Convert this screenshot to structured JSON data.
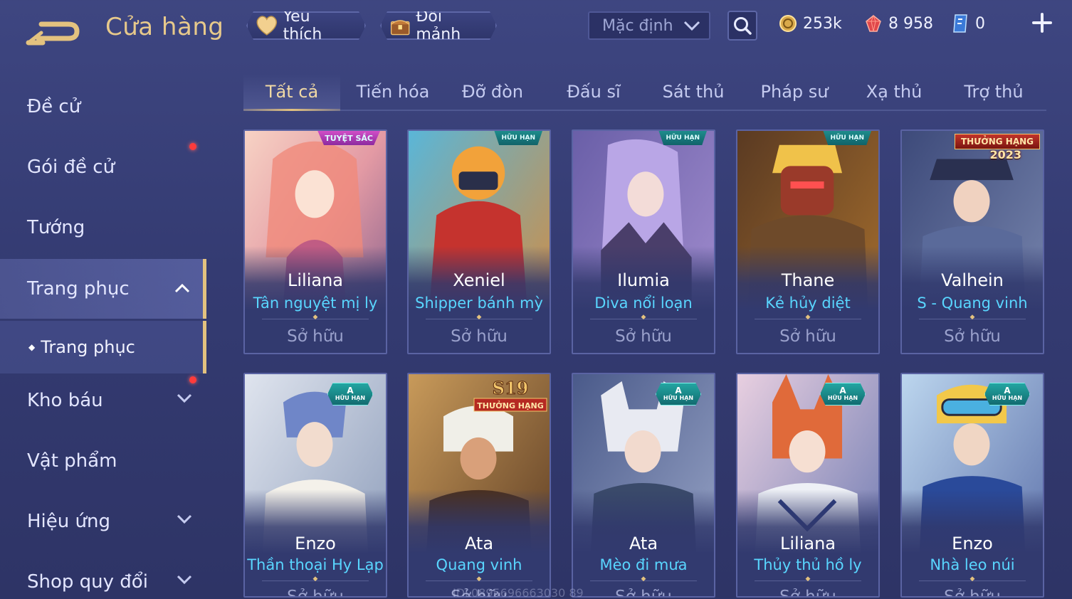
{
  "header": {
    "title": "Cửa hàng",
    "favorite_label": "Yêu thích",
    "swap_label": "Đổi mảnh",
    "sort_value": "Mặc định",
    "currencies": [
      {
        "name": "gold-coin-icon",
        "value": "253k"
      },
      {
        "name": "red-gem-icon",
        "value": "8 958"
      },
      {
        "name": "voucher-icon",
        "value": "0"
      }
    ]
  },
  "sidebar": {
    "items": [
      {
        "label": "Đề cử"
      },
      {
        "label": "Gói đề cử",
        "dot": true
      },
      {
        "label": "Tướng"
      },
      {
        "label": "Trang phục",
        "expanded": true
      },
      {
        "label": "Trang phục"
      },
      {
        "label": "Kho báu",
        "dot": true
      },
      {
        "label": "Vật phẩm"
      },
      {
        "label": "Hiệu ứng"
      },
      {
        "label": "Shop quy đổi"
      }
    ]
  },
  "tabs": [
    "Tất cả",
    "Tiến hóa",
    "Đỡ đòn",
    "Đấu sĩ",
    "Sát thủ",
    "Pháp sư",
    "Xạ thủ",
    "Trợ thủ"
  ],
  "active_tab": "Tất cả",
  "cards": [
    {
      "hero": "Liliana",
      "skin": "Tân nguyệt mị ly",
      "status": "Sở hữu",
      "badge": "TUYỆT SẮC"
    },
    {
      "hero": "Xeniel",
      "skin": "Shipper bánh mỳ",
      "status": "Sở hữu",
      "badge": "HỮU HẠN"
    },
    {
      "hero": "Ilumia",
      "skin": "Diva nổi loạn",
      "status": "Sở hữu",
      "badge": "HỮU HẠN"
    },
    {
      "hero": "Thane",
      "skin": "Kẻ hủy diệt",
      "status": "Sở hữu",
      "badge": "HỮU HẠN"
    },
    {
      "hero": "Valhein",
      "skin": "S - Quang vinh",
      "status": "Sở hữu",
      "badge": "THƯỞNG HẠNG",
      "badge_year": "2023"
    },
    {
      "hero": "Enzo",
      "skin": "Thần thoại Hy Lạp",
      "status": "Sở hữu",
      "badge": "HỮU HẠN",
      "badge_grade": "A"
    },
    {
      "hero": "Ata",
      "skin": "Quang vinh",
      "status": "Sở hữu",
      "badge": "THƯỞNG HẠNG",
      "badge_season": "S19"
    },
    {
      "hero": "Ata",
      "skin": "Mèo đi mưa",
      "status": "Sở hữu",
      "badge": "HỮU HẠN",
      "badge_grade": "A"
    },
    {
      "hero": "Liliana",
      "skin": "Thủy thủ hồ ly",
      "status": "Sở hữu",
      "badge": "HỮU HẠN",
      "badge_grade": "A"
    },
    {
      "hero": "Enzo",
      "skin": "Nhà leo núi",
      "status": "Sở hữu",
      "badge": "HỮU HẠN",
      "badge_grade": "A"
    }
  ],
  "watermark": "IDL0895696663030 89",
  "colors": {
    "accent_gold": "#e3c27f",
    "skin_blue": "#59d6ff",
    "background": "#3a4279",
    "notify_red": "#ff3b3b"
  }
}
